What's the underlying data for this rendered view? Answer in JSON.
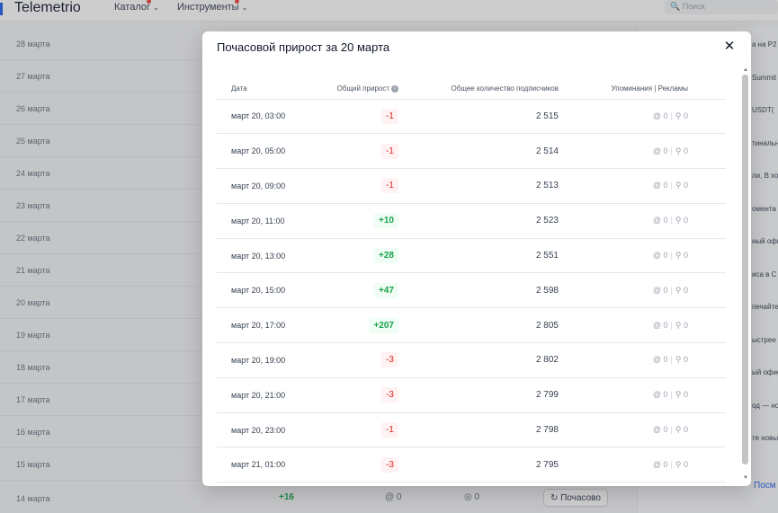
{
  "app": {
    "logo": "Telemetrio",
    "nav": [
      {
        "label": "Каталог",
        "chevron": "⌄"
      },
      {
        "label": "Инструменты",
        "chevron": "⌄"
      }
    ],
    "search_placeholder": "🔍 Поиск"
  },
  "background": {
    "dates": [
      "28 марта",
      "27 марта",
      "26 марта",
      "25 марта",
      "24 марта",
      "23 марта",
      "22 марта",
      "21 марта",
      "20 марта",
      "19 марта",
      "18 марта",
      "17 марта",
      "16 марта",
      "15 марта"
    ],
    "last_row": {
      "date": "14 марта",
      "growth": "+16",
      "mentions": "@ 0",
      "ads": "0",
      "hourly_button": "↻ Почасово"
    },
    "sidebar_snippets": [
      "а на P2",
      "Summit",
      "USDT(",
      "тинальн",
      "ли, В ход",
      "омента",
      "ный офи",
      "иса в С",
      "печайте н",
      "ыстрее",
      "ый офис",
      "од — но",
      "те новы"
    ],
    "sidebar_link": "Посм"
  },
  "modal": {
    "title": "Почасовой прирост за 20 марта",
    "close_icon": "✕",
    "columns": {
      "date": "Дата",
      "growth": "Общий прирост",
      "subscribers": "Общее количество подписчиков",
      "mentions_ads": "Упоминания | Рекламы"
    },
    "info_icon": "i",
    "mention_icon": "@",
    "ad_icon": "⚲",
    "rows": [
      {
        "date": "март 20, 03:00",
        "growth": "-1",
        "sign": "neg",
        "subscribers": "2 515",
        "mentions": "0",
        "ads": "0"
      },
      {
        "date": "март 20, 05:00",
        "growth": "-1",
        "sign": "neg",
        "subscribers": "2 514",
        "mentions": "0",
        "ads": "0"
      },
      {
        "date": "март 20, 09:00",
        "growth": "-1",
        "sign": "neg",
        "subscribers": "2 513",
        "mentions": "0",
        "ads": "0"
      },
      {
        "date": "март 20, 11:00",
        "growth": "+10",
        "sign": "pos",
        "subscribers": "2 523",
        "mentions": "0",
        "ads": "0"
      },
      {
        "date": "март 20, 13:00",
        "growth": "+28",
        "sign": "pos",
        "subscribers": "2 551",
        "mentions": "0",
        "ads": "0"
      },
      {
        "date": "март 20, 15:00",
        "growth": "+47",
        "sign": "pos",
        "subscribers": "2 598",
        "mentions": "0",
        "ads": "0"
      },
      {
        "date": "март 20, 17:00",
        "growth": "+207",
        "sign": "pos",
        "subscribers": "2 805",
        "mentions": "0",
        "ads": "0"
      },
      {
        "date": "март 20, 19:00",
        "growth": "-3",
        "sign": "neg",
        "subscribers": "2 802",
        "mentions": "0",
        "ads": "0"
      },
      {
        "date": "март 20, 21:00",
        "growth": "-3",
        "sign": "neg",
        "subscribers": "2 799",
        "mentions": "0",
        "ads": "0"
      },
      {
        "date": "март 20, 23:00",
        "growth": "-1",
        "sign": "neg",
        "subscribers": "2 798",
        "mentions": "0",
        "ads": "0"
      },
      {
        "date": "март 21, 01:00",
        "growth": "-3",
        "sign": "neg",
        "subscribers": "2 795",
        "mentions": "0",
        "ads": "0"
      }
    ]
  },
  "colors": {
    "positive": "#16a34a",
    "negative": "#dc2626",
    "accent": "#2563eb"
  }
}
